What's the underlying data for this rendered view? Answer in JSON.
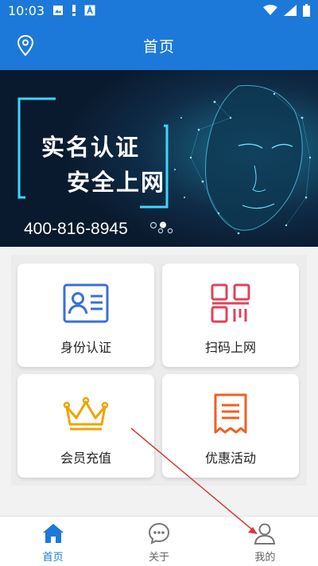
{
  "status_bar": {
    "time": "10:03",
    "icons": [
      "image-icon",
      "alert-icon",
      "a-icon",
      "wifi-icon",
      "signal-icon",
      "battery-icon"
    ]
  },
  "app_bar": {
    "title": "首页",
    "location_icon": "location-pin-icon"
  },
  "banner": {
    "line1": "实名认证",
    "line2": "安全上网",
    "phone": "400-816-8945",
    "dots": {
      "count": 3,
      "active": 1
    }
  },
  "features": [
    {
      "label": "身份认证",
      "icon": "id-card-icon",
      "color": "#3a6fd8"
    },
    {
      "label": "扫码上网",
      "icon": "qr-code-icon",
      "color": "#e0435a"
    },
    {
      "label": "会员充值",
      "icon": "crown-icon",
      "color": "#f0a400"
    },
    {
      "label": "优惠活动",
      "icon": "receipt-icon",
      "color": "#f06020"
    }
  ],
  "bottom_nav": {
    "items": [
      {
        "label": "首页",
        "icon": "home-icon",
        "active": true
      },
      {
        "label": "关于",
        "icon": "chat-bubble-icon",
        "active": false
      },
      {
        "label": "我的",
        "icon": "user-icon",
        "active": false
      }
    ]
  },
  "colors": {
    "primary": "#1d79d9",
    "background": "#f2f2f2",
    "annotation": "#d83a3a"
  }
}
